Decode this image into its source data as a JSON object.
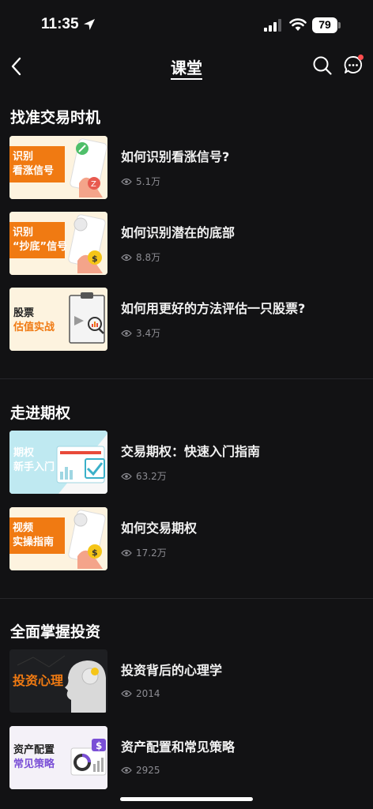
{
  "status": {
    "time": "11:35",
    "battery": "79"
  },
  "nav": {
    "title": "课堂"
  },
  "sections": [
    {
      "title": "找准交易时机",
      "items": [
        {
          "title": "如何识别看涨信号?",
          "views": "5.1万",
          "thumb_line1": "识别",
          "thumb_line2": "看涨信号"
        },
        {
          "title": "如何识别潜在的底部",
          "views": "8.8万",
          "thumb_line1": "识别",
          "thumb_line2": "“抄底”信号"
        },
        {
          "title": "如何用更好的方法评估一只股票?",
          "views": "3.4万",
          "thumb_line1": "股票",
          "thumb_line2": "估值实战"
        }
      ]
    },
    {
      "title": "走进期权",
      "items": [
        {
          "title": "交易期权：快速入门指南",
          "views": "63.2万",
          "thumb_line1": "期权",
          "thumb_line2": "新手入门"
        },
        {
          "title": "如何交易期权",
          "views": "17.2万",
          "thumb_line1": "视频",
          "thumb_line2": "实操指南"
        }
      ]
    },
    {
      "title": "全面掌握投资",
      "items": [
        {
          "title": "投资背后的心理学",
          "views": "2014",
          "thumb_line1": "投资心理",
          "thumb_line2": ""
        },
        {
          "title": "资产配置和常见策略",
          "views": "2925",
          "thumb_line1": "资产配置",
          "thumb_line2": "常见策略"
        }
      ]
    }
  ],
  "colors": {
    "background": "#121214",
    "accent_orange": "#f07a12",
    "thumb_cream": "#fdf3df",
    "thumb_lightblue": "#bfe9f1",
    "thumb_purple": "#7a4fd6",
    "notification_dot": "#ff4d4f"
  },
  "icons": [
    "location-arrow-icon",
    "signal-icon",
    "wifi-icon",
    "battery-icon",
    "back-icon",
    "search-icon",
    "chat-icon",
    "eye-icon"
  ]
}
